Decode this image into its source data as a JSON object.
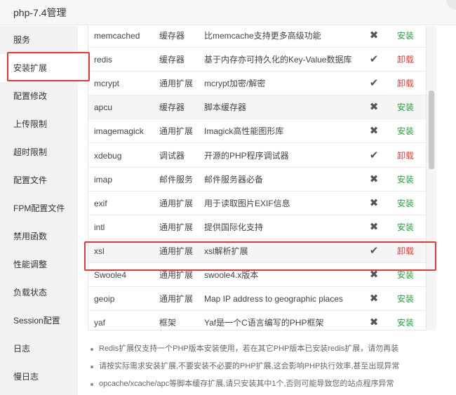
{
  "window": {
    "title": "php-7.4管理"
  },
  "sidebar": {
    "items": [
      {
        "label": "服务"
      },
      {
        "label": "安装扩展"
      },
      {
        "label": "配置修改"
      },
      {
        "label": "上传限制"
      },
      {
        "label": "超时限制"
      },
      {
        "label": "配置文件"
      },
      {
        "label": "FPM配置文件"
      },
      {
        "label": "禁用函数"
      },
      {
        "label": "性能调整"
      },
      {
        "label": "负载状态"
      },
      {
        "label": "Session配置"
      },
      {
        "label": "日志"
      },
      {
        "label": "慢日志"
      }
    ],
    "active_index": 1
  },
  "extensions": [
    {
      "name": "memcached",
      "type": "缓存器",
      "desc": "比memcache支持更多高级功能",
      "status": "not-installed",
      "status_icon": "✖",
      "action": "安装"
    },
    {
      "name": "redis",
      "type": "缓存器",
      "desc": "基于内存亦可持久化的Key-Value数据库",
      "status": "installed",
      "status_icon": "✔",
      "action": "卸载"
    },
    {
      "name": "mcrypt",
      "type": "通用扩展",
      "desc": "mcrypt加密/解密",
      "status": "installed",
      "status_icon": "✔",
      "action": "卸载"
    },
    {
      "name": "apcu",
      "type": "缓存器",
      "desc": "脚本缓存器",
      "status": "not-installed",
      "status_icon": "✖",
      "action": "安装"
    },
    {
      "name": "imagemagick",
      "type": "通用扩展",
      "desc": "Imagick高性能图形库",
      "status": "not-installed",
      "status_icon": "✖",
      "action": "安装"
    },
    {
      "name": "xdebug",
      "type": "调试器",
      "desc": "开源的PHP程序调试器",
      "status": "installed",
      "status_icon": "✔",
      "action": "卸载"
    },
    {
      "name": "imap",
      "type": "邮件服务",
      "desc": "邮件服务器必备",
      "status": "not-installed",
      "status_icon": "✖",
      "action": "安装"
    },
    {
      "name": "exif",
      "type": "通用扩展",
      "desc": "用于读取图片EXIF信息",
      "status": "not-installed",
      "status_icon": "✖",
      "action": "安装"
    },
    {
      "name": "intl",
      "type": "通用扩展",
      "desc": "提供国际化支持",
      "status": "not-installed",
      "status_icon": "✖",
      "action": "安装"
    },
    {
      "name": "xsl",
      "type": "通用扩展",
      "desc": "xsl解析扩展",
      "status": "installed",
      "status_icon": "✔",
      "action": "卸载"
    },
    {
      "name": "Swoole4",
      "type": "通用扩展",
      "desc": "swoole4.x版本",
      "status": "not-installed",
      "status_icon": "✖",
      "action": "安装"
    },
    {
      "name": "geoip",
      "type": "通用扩展",
      "desc": "Map IP address to geographic places",
      "status": "not-installed",
      "status_icon": "✖",
      "action": "安装"
    },
    {
      "name": "yaf",
      "type": "框架",
      "desc": "Yaf是一个C语言编写的PHP框架",
      "status": "not-installed",
      "status_icon": "✖",
      "action": "安装"
    }
  ],
  "tips": [
    "Redis扩展仅支持一个PHP版本安装使用，若在其它PHP版本已安装redis扩展，请勿再装",
    "请按实际需求安装扩展,不要安装不必要的PHP扩展,这会影响PHP执行效率,甚至出现异常",
    "opcache/xcache/apc等脚本缓存扩展,请只安装其中1个,否则可能导致您的站点程序异常"
  ],
  "colors": {
    "install": "#20a53a",
    "uninstall": "#e53935",
    "highlight": "#e53935"
  }
}
